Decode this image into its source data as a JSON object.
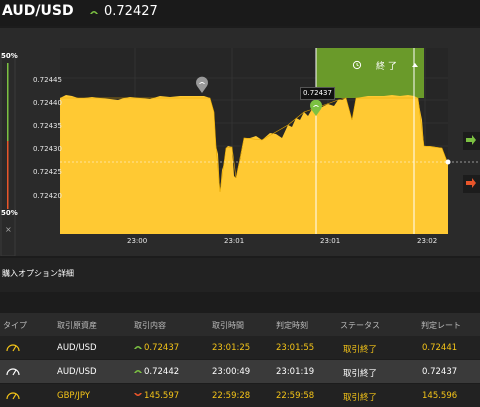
{
  "header": {
    "pair": "AUD/USD",
    "price": "0.72427",
    "arrow_color": "#7cc142"
  },
  "chart": {
    "y_ticks": [
      "0.72445",
      "0.72440",
      "0.72435",
      "0.72430",
      "0.72425",
      "0.72420"
    ],
    "x_ticks": [
      "23:00",
      "23:01",
      "23:01",
      "23:02"
    ],
    "gauge_top": "50%",
    "gauge_bottom": "50%",
    "close_label": "× ",
    "expiry_label": "終 了",
    "expiry_clock_icon": "clock-icon",
    "entry_price_tag": "0.72437",
    "area_color": "#ffc933",
    "expiry_color": "#6a9a2a"
  },
  "details": {
    "title": "購入オプション詳細"
  },
  "table": {
    "headers": [
      "タイプ",
      "取引原資産",
      "取引内容",
      "取引時間",
      "判定時刻",
      "ステータス",
      "判定レート"
    ],
    "rows": [
      {
        "asset": "AUD/USD",
        "direction": "up",
        "rate": "0.72437",
        "trade_time": "23:01:25",
        "judge_time": "23:01:55",
        "status": "取引終了",
        "judge_rate": "0.72441"
      },
      {
        "asset": "AUD/USD",
        "direction": "up",
        "rate": "0.72442",
        "trade_time": "23:00:49",
        "judge_time": "23:01:19",
        "status": "取引終了",
        "judge_rate": "0.72437"
      },
      {
        "asset": "GBP/JPY",
        "direction": "down",
        "rate": "145.597",
        "trade_time": "22:59:28",
        "judge_time": "22:59:58",
        "status": "取引終了",
        "judge_rate": "145.596"
      }
    ]
  }
}
